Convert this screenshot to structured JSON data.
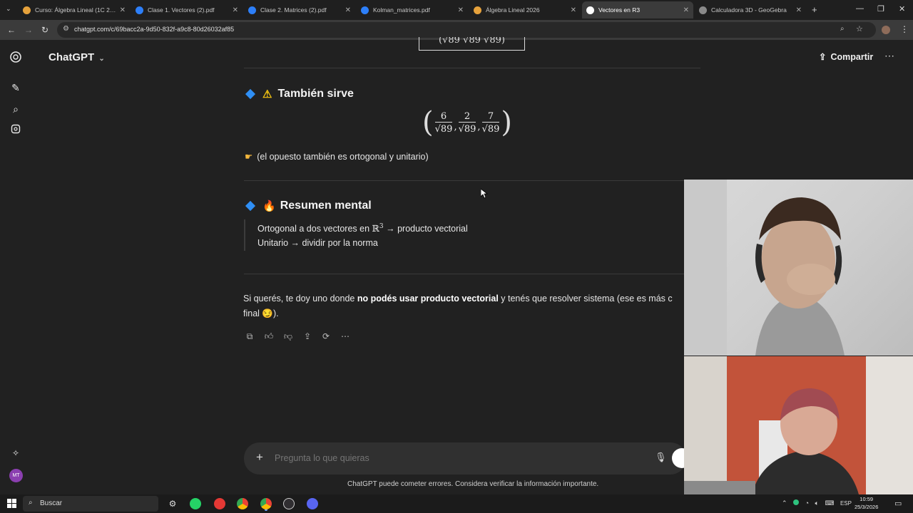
{
  "browser": {
    "tabs": [
      {
        "title": "Curso: Álgebra Lineal (1C 2026)",
        "color": "#e6a23c"
      },
      {
        "title": "Clase 1. Vectores (2).pdf",
        "color": "#2d7ff9"
      },
      {
        "title": "Clase 2. Matrices (2).pdf",
        "color": "#2d7ff9"
      },
      {
        "title": "Kolman_matrices.pdf",
        "color": "#2d7ff9"
      },
      {
        "title": "Álgebra Lineal 2026",
        "color": "#e6a23c"
      },
      {
        "title": "Vectores en R3",
        "color": "#ffffff"
      },
      {
        "title": "Calculadora 3D - GeoGebra",
        "color": "#8a8a8a"
      }
    ],
    "url": "chatgpt.com/c/69bacc2a-9d50-832f-a9c8-80d26032af85"
  },
  "app": {
    "brand": "ChatGPT",
    "share_label": "Compartir"
  },
  "content": {
    "top_partial": "(√89  √89  √89)",
    "section1": {
      "title": "También sirve",
      "vector": [
        {
          "num": "6",
          "den": "√89"
        },
        {
          "num": "2",
          "den": "√89"
        },
        {
          "num": "7",
          "den": "√89"
        }
      ],
      "note": "(el opuesto también es ortogonal y unitario)"
    },
    "section2": {
      "title": "Resumen mental",
      "line1_pre": "Ortogonal a dos vectores en ",
      "line1_space": "ℝ",
      "line1_exp": "3",
      "line1_post": " → producto vectorial",
      "line2": "Unitario → dividir por la norma"
    },
    "closing": {
      "pre": "Si querés, te doy uno donde ",
      "bold": "no podés usar producto vectorial",
      "post": " y tenés que resolver sistema (ese es más c",
      "line2": "final 😏)."
    }
  },
  "composer": {
    "placeholder": "Pregunta lo que quieras",
    "disclaimer": "ChatGPT puede cometer errores. Considera verificar la información importante."
  },
  "taskbar": {
    "search": "Buscar",
    "lang": "ESP",
    "time": "10:59",
    "date": "25/3/2026"
  },
  "rail": {
    "avatar": "MT"
  }
}
